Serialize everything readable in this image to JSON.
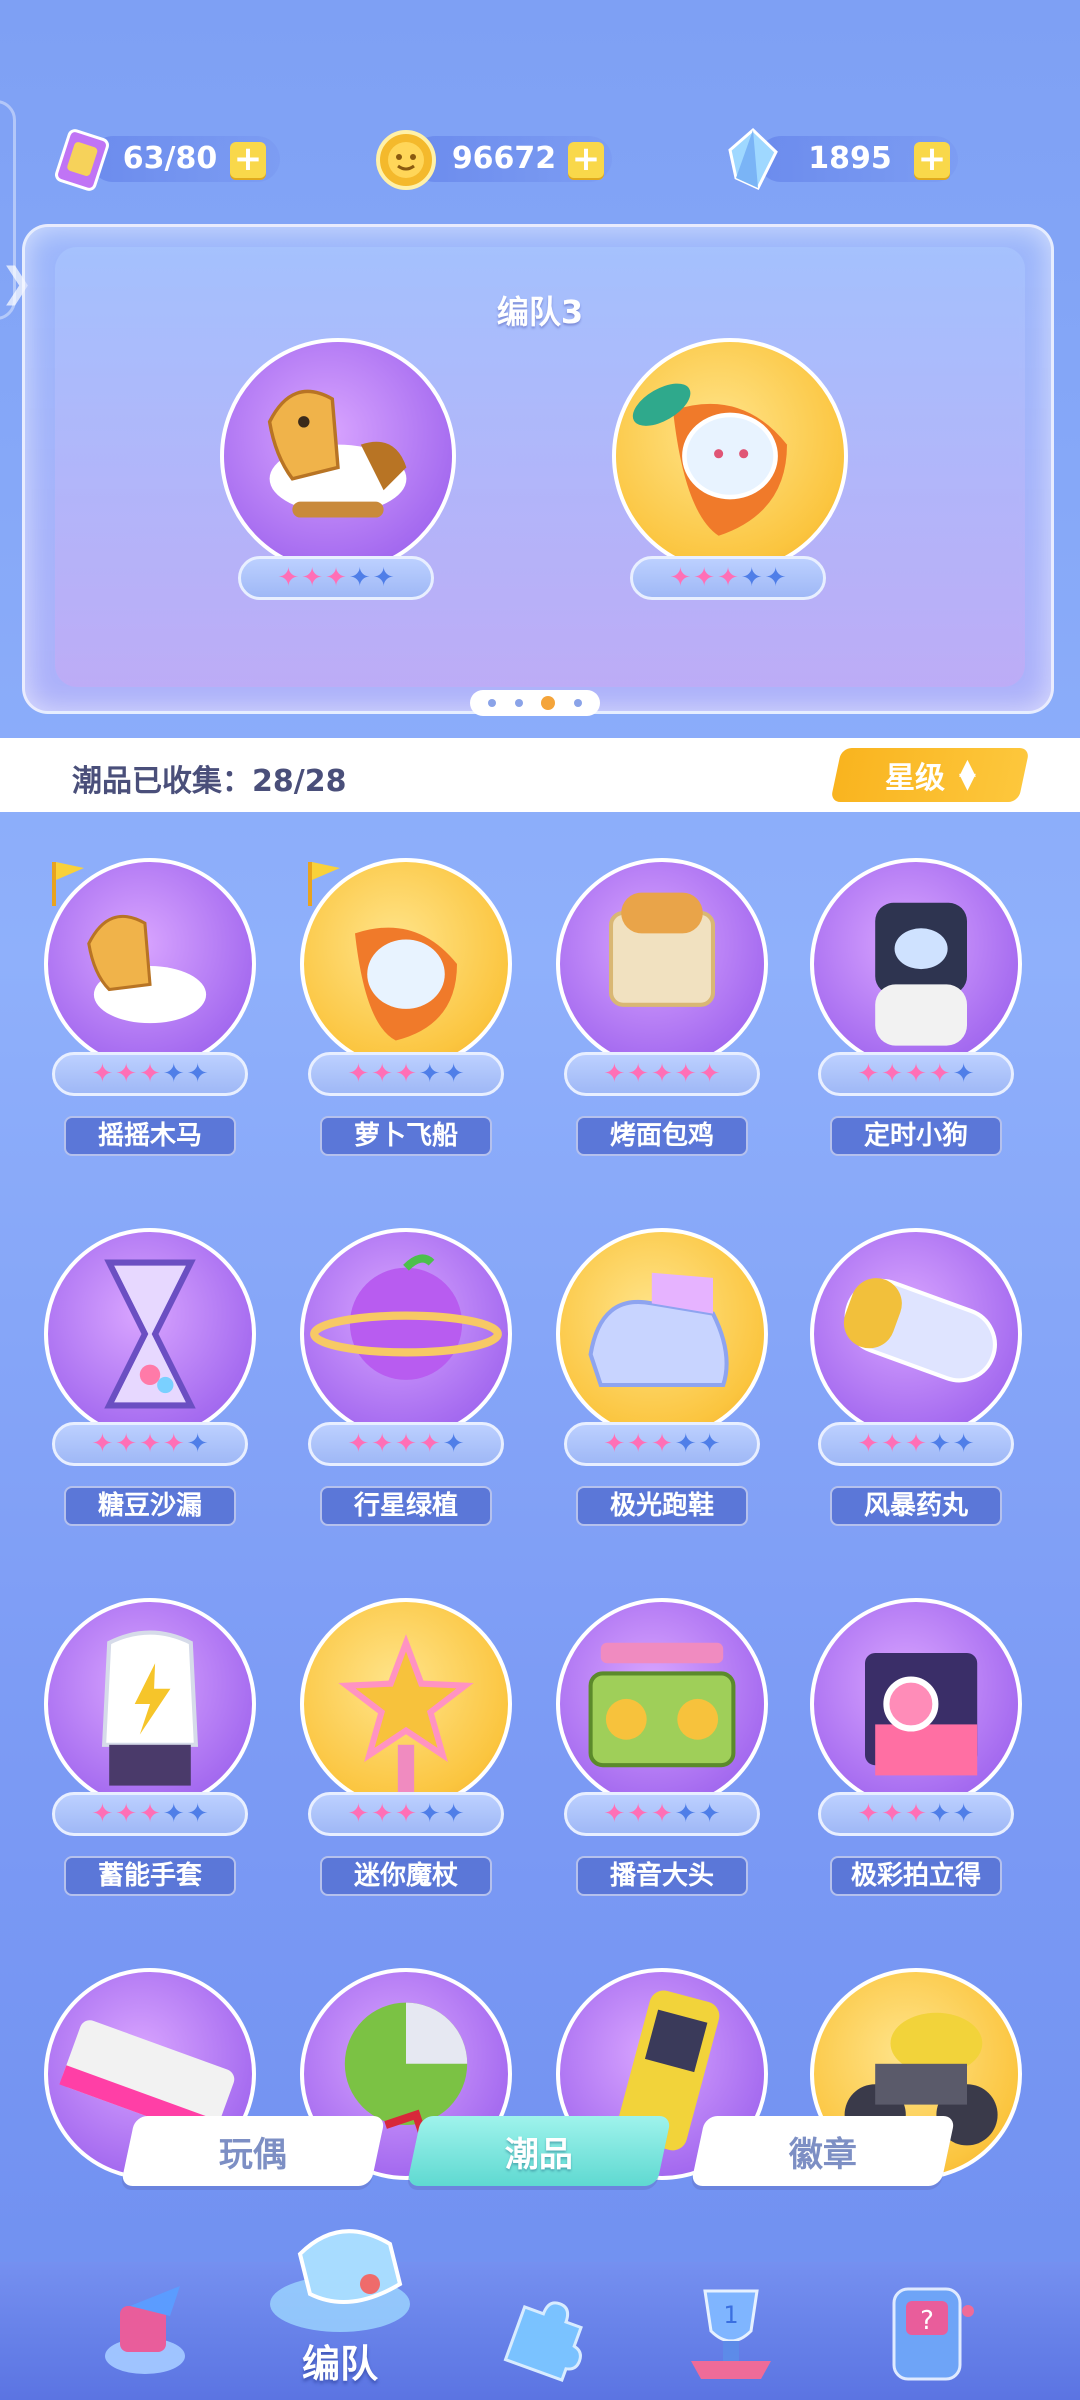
{
  "resources": {
    "energy": {
      "value": "63/80",
      "icon": "ticket-icon"
    },
    "coins": {
      "value": "96672",
      "icon": "coin-icon"
    },
    "gems": {
      "value": "1895",
      "icon": "crystal-icon"
    }
  },
  "team": {
    "title": "编队3",
    "members": [
      {
        "stars": 3,
        "max_stars": 5,
        "icon": "rocking-horse"
      },
      {
        "stars": 3,
        "max_stars": 5,
        "icon": "carrot-ship"
      }
    ],
    "page_count": 4,
    "current_page": 3
  },
  "collection": {
    "label": "潮品已收集：28/28",
    "sort_label": "星级"
  },
  "items": [
    {
      "name": "摇摇木马",
      "stars": 3,
      "bg": "purple",
      "flag": true
    },
    {
      "name": "萝卜飞船",
      "stars": 3,
      "bg": "gold",
      "flag": true
    },
    {
      "name": "烤面包鸡",
      "stars": 5,
      "bg": "purple",
      "flag": false
    },
    {
      "name": "定时小狗",
      "stars": 4,
      "bg": "purple",
      "flag": false
    },
    {
      "name": "糖豆沙漏",
      "stars": 4,
      "bg": "purple",
      "flag": false
    },
    {
      "name": "行星绿植",
      "stars": 4,
      "bg": "purple",
      "flag": false
    },
    {
      "name": "极光跑鞋",
      "stars": 3,
      "bg": "gold",
      "flag": false
    },
    {
      "name": "风暴药丸",
      "stars": 3,
      "bg": "purple",
      "flag": false
    },
    {
      "name": "蓄能手套",
      "stars": 3,
      "bg": "purple",
      "flag": false
    },
    {
      "name": "迷你魔杖",
      "stars": 3,
      "bg": "gold",
      "flag": false
    },
    {
      "name": "播音大头",
      "stars": 3,
      "bg": "purple",
      "flag": false
    },
    {
      "name": "极彩拍立得",
      "stars": 3,
      "bg": "purple",
      "flag": false
    },
    {
      "name": "",
      "stars": 0,
      "bg": "purple",
      "flag": false
    },
    {
      "name": "",
      "stars": 0,
      "bg": "purple",
      "flag": false
    },
    {
      "name": "",
      "stars": 0,
      "bg": "purple",
      "flag": false
    },
    {
      "name": "",
      "stars": 0,
      "bg": "gold",
      "flag": false
    }
  ],
  "category_tabs": [
    "玩偶",
    "潮品",
    "徽章"
  ],
  "active_category": 1,
  "bottom_nav": {
    "active_label": "编队",
    "items": [
      "gift-icon",
      "whistle-icon",
      "puzzle-icon",
      "trophy-icon",
      "slot-machine-icon"
    ]
  },
  "colors": {
    "star_full": "#ff6fb6",
    "star_empty": "#4f7ee8",
    "accent_gold": "#f9b41f",
    "active_tab": "#5fd9d1"
  }
}
